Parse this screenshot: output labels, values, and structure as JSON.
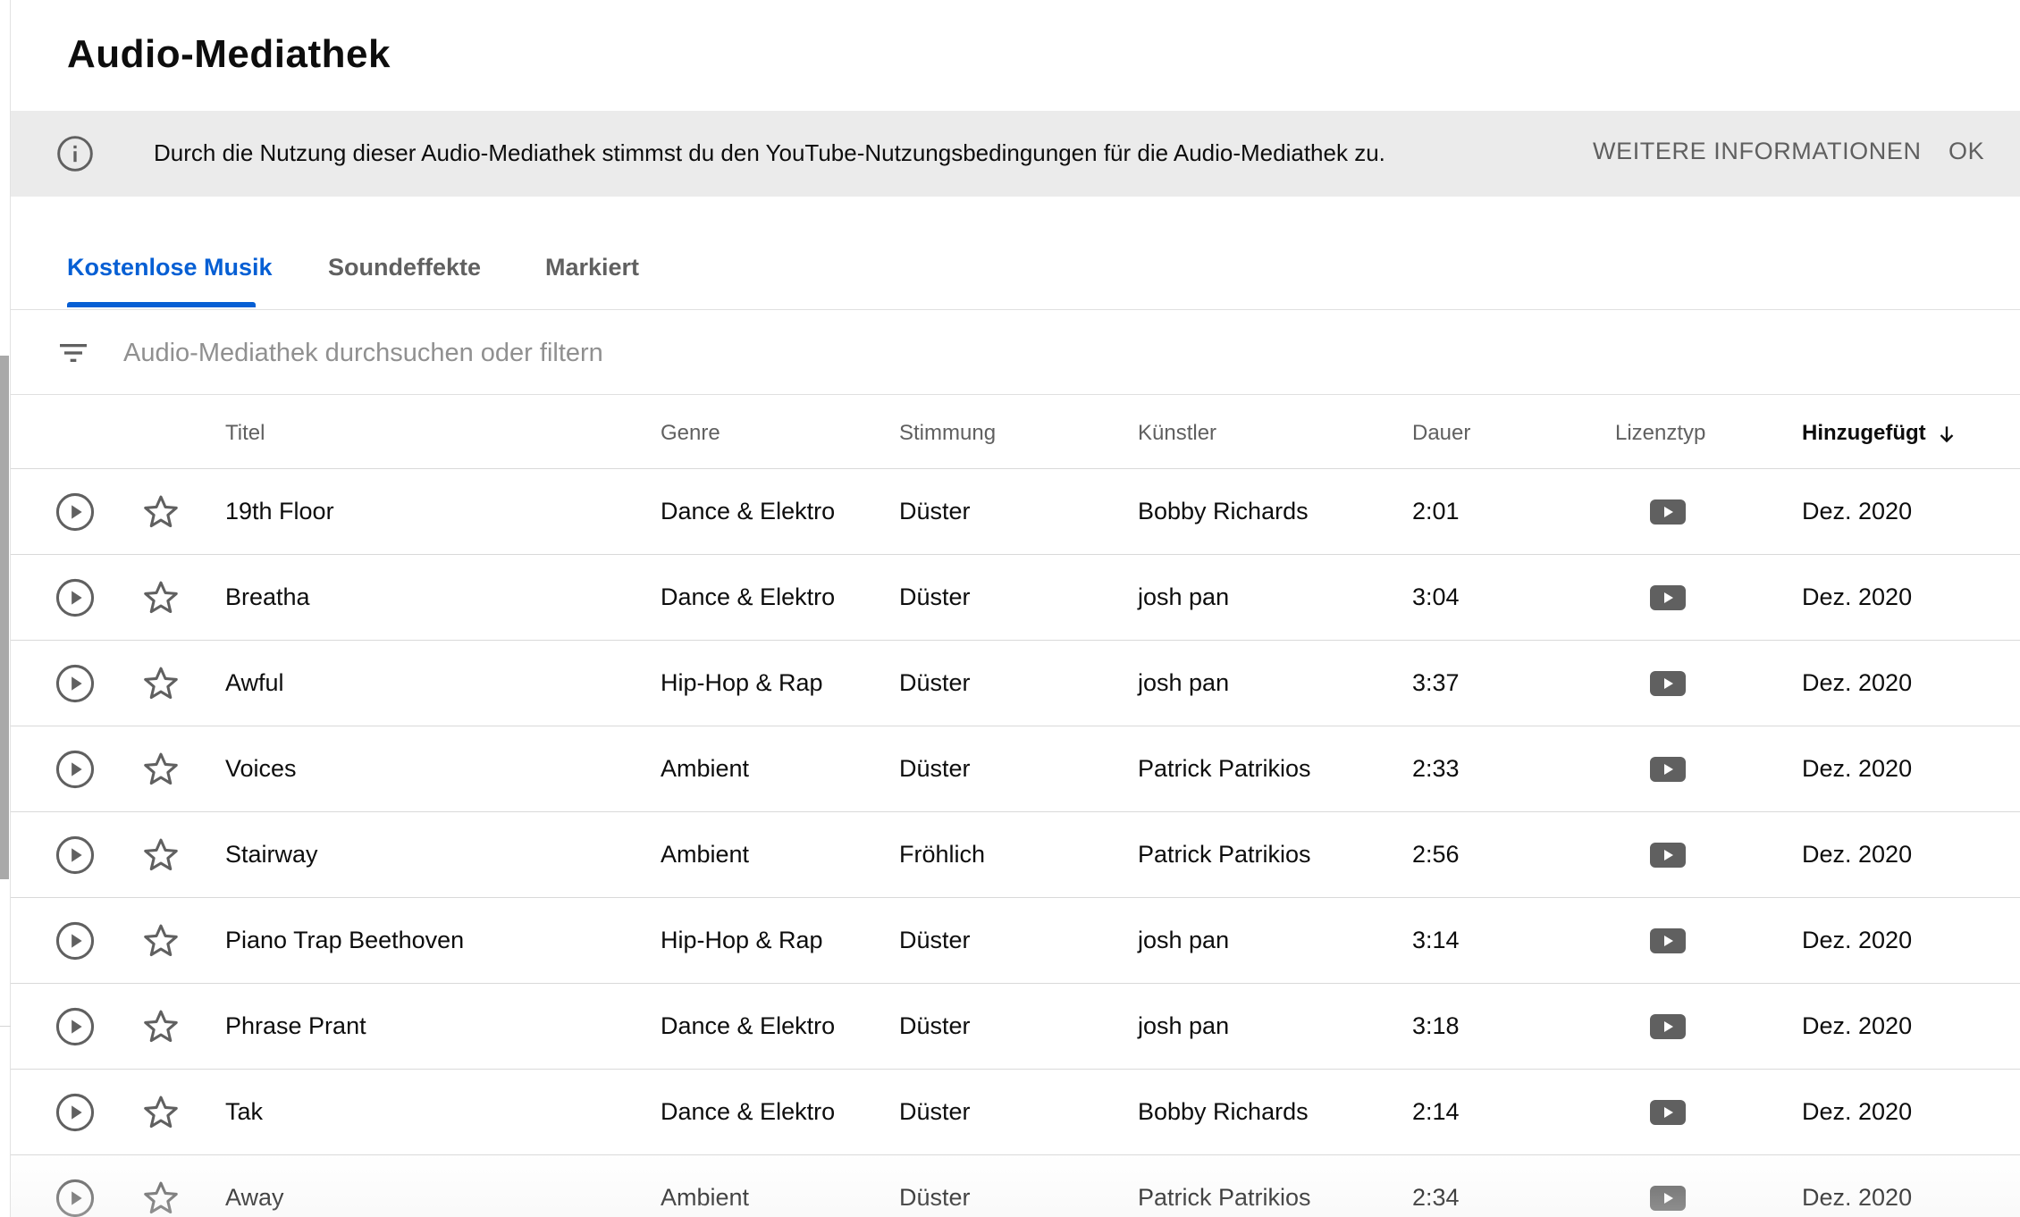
{
  "page": {
    "title": "Audio-Mediathek"
  },
  "banner": {
    "text": "Durch die Nutzung dieser Audio-Mediathek stimmst du den YouTube-Nutzungsbedingungen für die Audio-Mediathek zu.",
    "more_label": "WEITERE INFORMATIONEN",
    "ok_label": "OK",
    "icon": "info-icon"
  },
  "tabs": [
    {
      "label": "Kostenlose Musik",
      "active": true
    },
    {
      "label": "Soundeffekte",
      "active": false
    },
    {
      "label": "Markiert",
      "active": false
    }
  ],
  "search": {
    "placeholder": "Audio-Mediathek durchsuchen oder filtern",
    "value": "",
    "icon": "filter-icon"
  },
  "table": {
    "headers": {
      "title": "Titel",
      "genre": "Genre",
      "mood": "Stimmung",
      "artist": "Künstler",
      "duration": "Dauer",
      "license": "Lizenztyp",
      "added": "Hinzugefügt"
    },
    "sorted_by": "added",
    "sort_direction": "descending",
    "rows": [
      {
        "title": "19th Floor",
        "genre": "Dance & Elektro",
        "mood": "Düster",
        "artist": "Bobby Richards",
        "duration": "2:01",
        "license": "youtube-icon",
        "added": "Dez. 2020"
      },
      {
        "title": "Breatha",
        "genre": "Dance & Elektro",
        "mood": "Düster",
        "artist": "josh pan",
        "duration": "3:04",
        "license": "youtube-icon",
        "added": "Dez. 2020"
      },
      {
        "title": "Awful",
        "genre": "Hip-Hop & Rap",
        "mood": "Düster",
        "artist": "josh pan",
        "duration": "3:37",
        "license": "youtube-icon",
        "added": "Dez. 2020"
      },
      {
        "title": "Voices",
        "genre": "Ambient",
        "mood": "Düster",
        "artist": "Patrick Patrikios",
        "duration": "2:33",
        "license": "youtube-icon",
        "added": "Dez. 2020"
      },
      {
        "title": "Stairway",
        "genre": "Ambient",
        "mood": "Fröhlich",
        "artist": "Patrick Patrikios",
        "duration": "2:56",
        "license": "youtube-icon",
        "added": "Dez. 2020"
      },
      {
        "title": "Piano Trap Beethoven",
        "genre": "Hip-Hop & Rap",
        "mood": "Düster",
        "artist": "josh pan",
        "duration": "3:14",
        "license": "youtube-icon",
        "added": "Dez. 2020"
      },
      {
        "title": "Phrase Prant",
        "genre": "Dance & Elektro",
        "mood": "Düster",
        "artist": "josh pan",
        "duration": "3:18",
        "license": "youtube-icon",
        "added": "Dez. 2020"
      },
      {
        "title": "Tak",
        "genre": "Dance & Elektro",
        "mood": "Düster",
        "artist": "Bobby Richards",
        "duration": "2:14",
        "license": "youtube-icon",
        "added": "Dez. 2020"
      },
      {
        "title": "Away",
        "genre": "Ambient",
        "mood": "Düster",
        "artist": "Patrick Patrikios",
        "duration": "2:34",
        "license": "youtube-icon",
        "added": "Dez. 2020"
      }
    ]
  },
  "colors": {
    "accent": "#065fd4",
    "banner_bg": "#ebebeb",
    "icon_gray": "#606060"
  }
}
